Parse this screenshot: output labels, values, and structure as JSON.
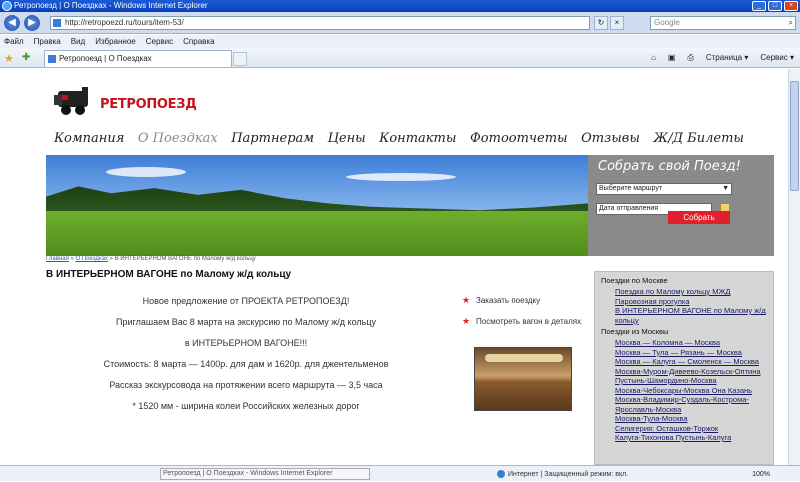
{
  "window": {
    "title": "Ретропоезд | О Поездках - Windows Internet Explorer",
    "min": "_",
    "max": "□",
    "close": "×"
  },
  "browser": {
    "url": "http://retropoezd.ru/tours/item-53/",
    "search_placeholder": "Google",
    "back": "◀",
    "forward": "▶",
    "menu": [
      "Файл",
      "Правка",
      "Вид",
      "Избранное",
      "Сервис",
      "Справка"
    ],
    "tab_title": "Ретропоезд | О Поездках",
    "tools": [
      "Страница ▾",
      "Сервис ▾"
    ],
    "status_tooltip": "Ретропоезд | О Поездках - Windows Internet Explorer",
    "status_zone": "Интернет | Защищенный режим: вкл.",
    "zoom": "100%"
  },
  "site": {
    "logo_text": "РЕТРОПОЕЗД",
    "nav": [
      "Компания",
      "О Поездках",
      "Партнерам",
      "Цены",
      "Контакты",
      "Фотоотчеты",
      "Отзывы",
      "Ж/Д Билеты"
    ],
    "nav_active_index": 1
  },
  "booking": {
    "title": "Собрать свой Поезд!",
    "route_value": "Выберите маршрут",
    "date_value": "Дата отправления",
    "submit_label": "Собрать"
  },
  "breadcrumb": {
    "items": [
      "Главная",
      "О Поездках"
    ],
    "current": "В ИНТЕРЬЕРНОМ ВАГОНЕ по Малому ж/д кольцу",
    "sep": " » "
  },
  "article": {
    "title": "В ИНТЕРЬЕРНОМ ВАГОНЕ по Малому ж/д кольцу",
    "lines": [
      "Новое предложение от ПРОЕКТА РЕТРОПОЕЗД!",
      "Приглашаем Вас 8 марта на экскурсию по Малому ж/д кольцу",
      "в ИНТЕРЬЕРНОМ ВАГОНЕ!!!",
      "Стоимость: 8 марта — 1400р. для дам и 1620р. для джентельменов",
      "Рассказ экскурсовода на протяжении всего маршрута — 3,5 часа",
      "* 1520 мм - ширина колеи Российских железных дорог"
    ],
    "actions": [
      "Заказать поездку",
      "Посмотреть вагон в деталях"
    ]
  },
  "sidebar": {
    "section1_title": "Поездки по Москве",
    "section1_items": [
      "Поездка по Малому кольцу МЖД",
      "Паровозная прогулка",
      "В ИНТЕРЬЕРНОМ ВАГОНЕ по Малому ж/д кольцу"
    ],
    "section2_title": "Поездки из Москвы",
    "section2_items": [
      "Москва — Коломна — Москва",
      "Москва — Тула — Рязань — Москва",
      "Москва — Калуга — Смоленск — Москва",
      "Москва-Муром-Дивеево-Козельск-Оптина",
      "Пустынь-Шамордино-Москва",
      "Москва-Чебоксары-Москва Она Казань",
      "Москва-Владимир-Суздаль-Кострома-Ярославль-Москва",
      "Москва-Тула-Москва",
      "Селигерия: Осташков-Торжок",
      "Калуга-Тихонова Пустынь-Калуга"
    ]
  }
}
